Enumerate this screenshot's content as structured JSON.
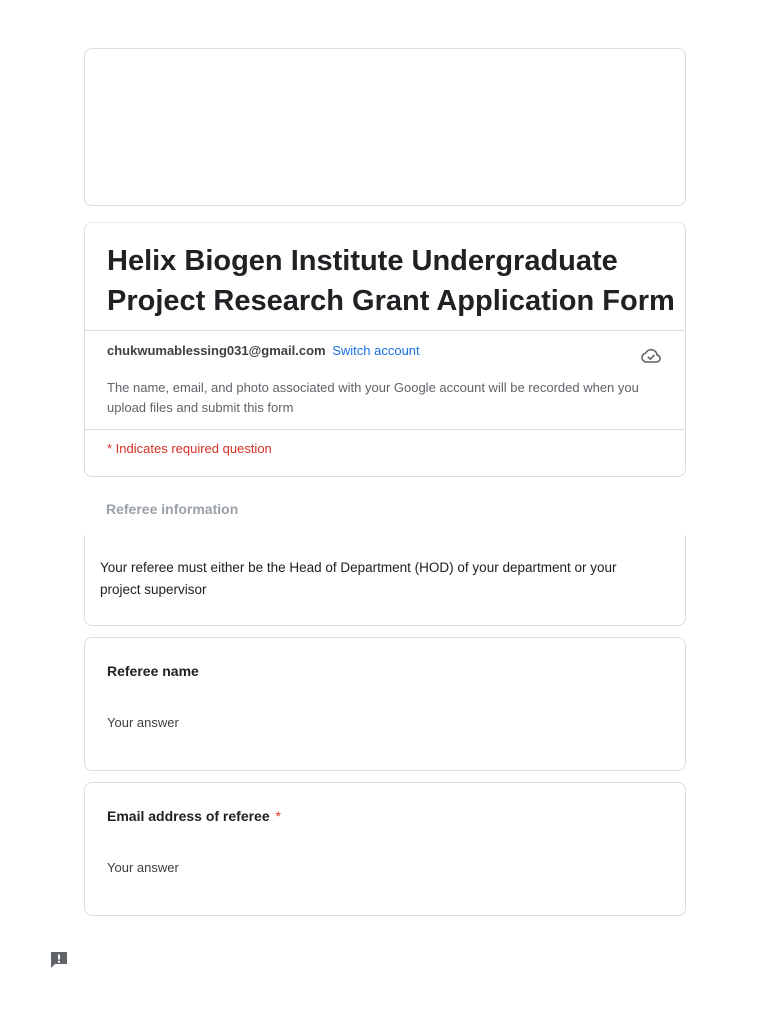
{
  "form": {
    "title": "Helix Biogen Institute Undergraduate Project Research Grant Application Form",
    "account_email": "chukwumablessing031@gmail.com",
    "switch_account": "Switch account",
    "privacy_note": "The name, email, and photo associated with your Google account will be recorded when you upload files and submit this form",
    "required_note": "* Indicates required question"
  },
  "section": {
    "header": "Referee information",
    "description": "Your referee must either be the Head of Department (HOD) of your department or your project supervisor"
  },
  "questions": [
    {
      "label": "Referee name",
      "required": false,
      "placeholder": "Your answer"
    },
    {
      "label": "Email address of referee",
      "required": true,
      "required_mark": "*",
      "placeholder": "Your answer"
    }
  ],
  "icons": {
    "cloud": "cloud-saved-icon",
    "report": "report-problem-icon"
  },
  "colors": {
    "link": "#1a73e8",
    "required": "#d93025",
    "border": "#dadce0"
  }
}
